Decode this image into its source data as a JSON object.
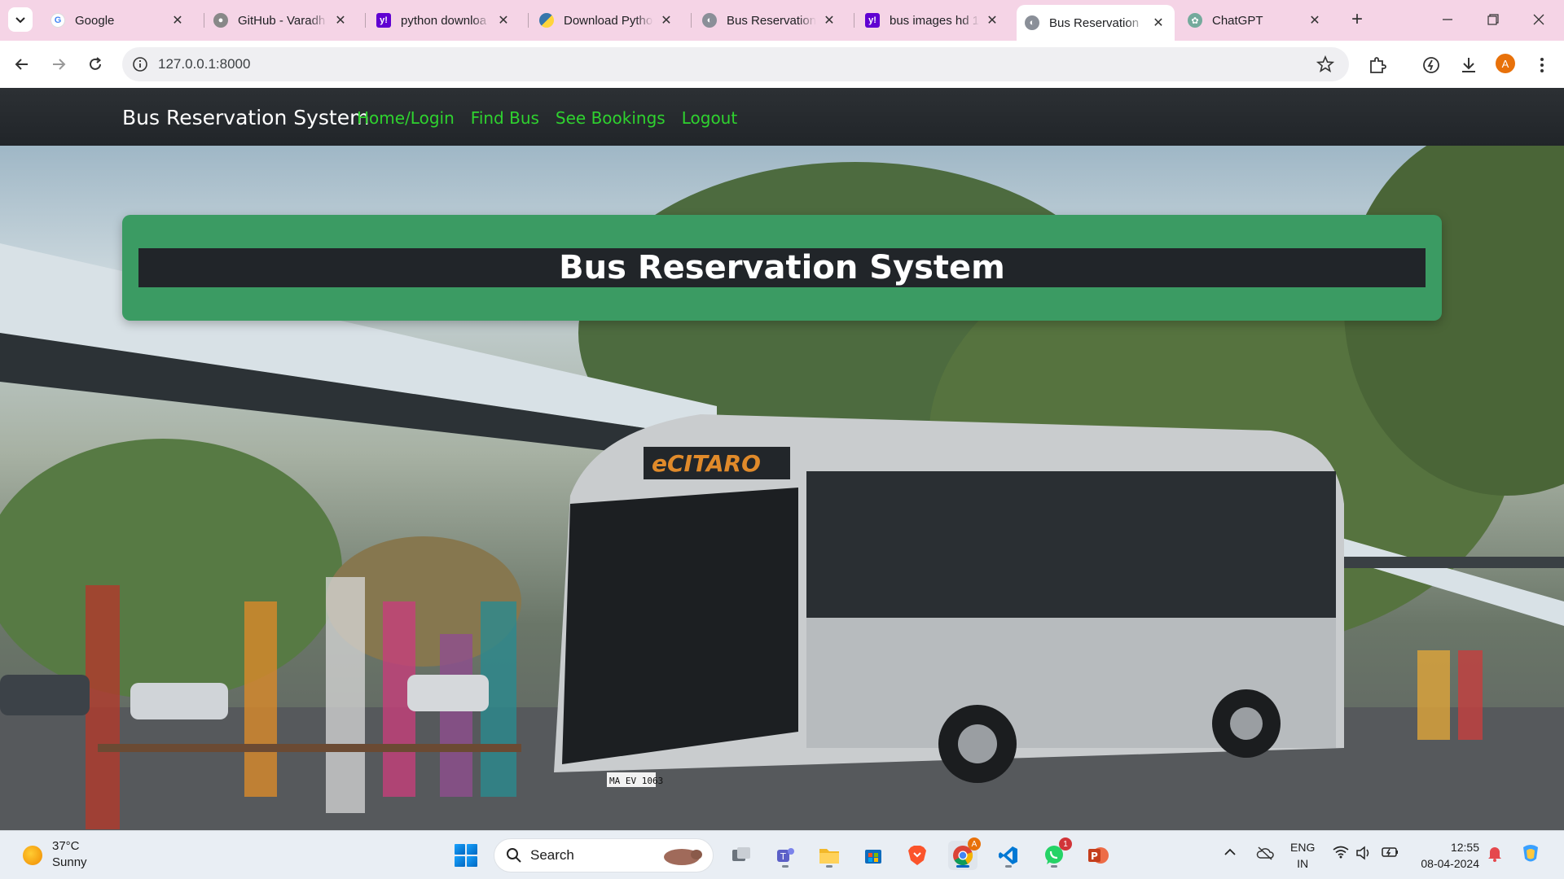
{
  "browser": {
    "tabs": [
      {
        "title": "Google",
        "icon": "google-icon",
        "active": false
      },
      {
        "title": "GitHub - Varadh",
        "icon": "github-icon",
        "active": false
      },
      {
        "title": "python downloa",
        "icon": "yahoo-icon",
        "active": false
      },
      {
        "title": "Download Pytho",
        "icon": "python-icon",
        "active": false
      },
      {
        "title": "Bus Reservation :",
        "icon": "globe-icon",
        "active": false
      },
      {
        "title": "bus images hd 1",
        "icon": "yahoo-icon",
        "active": false
      },
      {
        "title": "Bus Reservation",
        "icon": "globe-icon",
        "active": true
      },
      {
        "title": "ChatGPT",
        "icon": "chatgpt-icon",
        "active": false
      }
    ],
    "address": "127.0.0.1:8000",
    "profile_initial": "A"
  },
  "site": {
    "brand": "Bus Reservation System",
    "nav": [
      {
        "label": "Home/Login"
      },
      {
        "label": "Find Bus"
      },
      {
        "label": "See Bookings"
      },
      {
        "label": "Logout"
      }
    ],
    "banner_title": "Bus Reservation System",
    "bus_display": "eCITARO",
    "plate": "MA EV 1063",
    "colors": {
      "nav_bg": "#212529",
      "nav_link": "#2fd22f",
      "banner_green": "#3b9b63"
    }
  },
  "taskbar": {
    "weather": {
      "temp": "37°C",
      "condition": "Sunny"
    },
    "search_label": "Search",
    "whatsapp_badge": "1",
    "chrome_badge": "A",
    "lang_line1": "ENG",
    "lang_line2": "IN",
    "time": "12:55",
    "date": "08-04-2024"
  }
}
